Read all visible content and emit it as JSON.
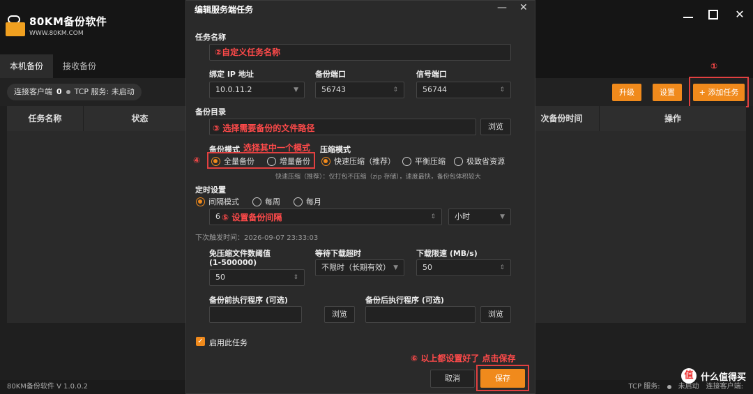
{
  "app": {
    "logo_title": "80KM备份软件",
    "logo_sub": "WWW.80KM.COM",
    "tabs": [
      "本机备份",
      "接收备份"
    ],
    "status": {
      "clients_label": "连接客户端",
      "clients_count": "0",
      "tcp_label": "TCP 服务: 未启动"
    },
    "buttons": {
      "upgrade": "升级",
      "settings": "设置",
      "add_task": "+ 添加任务"
    },
    "table_headers": [
      "任务名称",
      "状态",
      "次备份时间",
      "操作"
    ],
    "footer": {
      "version": "80KM备份软件 V 1.0.0.2",
      "tcp": "TCP 服务:",
      "tcp_state": "未启动",
      "clients": "连接客户端:"
    },
    "watermark": {
      "badge": "值",
      "text": "什么值得买"
    }
  },
  "dialog": {
    "title": "编辑服务端任务",
    "task_name_label": "任务名称",
    "bind_ip_label": "绑定 IP 地址",
    "bind_ip_value": "10.0.11.2",
    "backup_port_label": "备份端口",
    "backup_port_value": "56743",
    "signal_port_label": "信号端口",
    "signal_port_value": "56744",
    "backup_dir_label": "备份目录",
    "browse": "浏览",
    "backup_mode_label": "备份模式",
    "mode_full": "全量备份",
    "mode_incr": "增量备份",
    "compress_label": "压缩模式",
    "compress_fast": "快速压缩（推荐）",
    "compress_balanced": "平衡压缩",
    "compress_min": "极致省资源",
    "compress_hint": "快速压缩（推荐）：仅打包不压缩（zip 存储），速度最快，备份包体积较大",
    "schedule_label": "定时设置",
    "sched_interval": "间隔模式",
    "sched_weekly": "每周",
    "sched_monthly": "每月",
    "interval_value": "6",
    "interval_unit": "小时",
    "next_trigger": "下次触发时间：2026-09-07 23:33:03",
    "skip_threshold_label": "免压缩文件数阈值",
    "skip_threshold_range": "(1-500000)",
    "skip_threshold_value": "50",
    "wait_timeout_label": "等待下载超时",
    "wait_timeout_value": "不限时（长期有效）",
    "download_limit_label": "下载限速 (MB/s)",
    "download_limit_value": "50",
    "pre_exec_label": "备份前执行程序 (可选)",
    "post_exec_label": "备份后执行程序 (可选)",
    "enable_label": "启用此任务",
    "cancel": "取消",
    "save": "保存"
  },
  "annotations": {
    "a1": "①",
    "a2": "②自定义任务名称",
    "a3": "③ 选择需要备份的文件路径",
    "a4_title": "选择其中一个模式",
    "a4": "④",
    "a5": "⑤  设置备份间隔",
    "a6": "⑥ 以上都设置好了 点击保存"
  }
}
